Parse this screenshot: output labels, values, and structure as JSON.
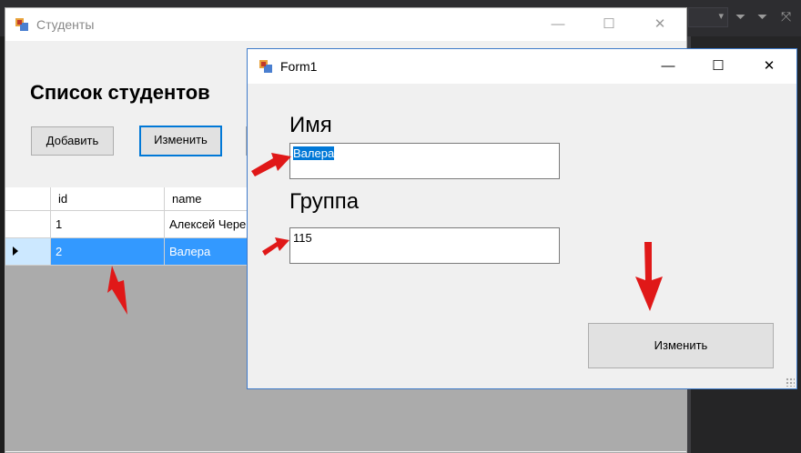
{
  "back_window": {
    "title": "Студенты",
    "heading": "Список студентов",
    "buttons": {
      "add": "Добавить",
      "edit": "Изменить"
    },
    "grid": {
      "columns": [
        "id",
        "name"
      ],
      "rows": [
        {
          "id": "1",
          "name": "Алексей Чере"
        },
        {
          "id": "2",
          "name": "Валера",
          "selected": true
        }
      ]
    }
  },
  "form": {
    "title": "Form1",
    "name_label": "Имя",
    "name_value": "Валера",
    "group_label": "Группа",
    "group_value": "115",
    "submit_label": "Изменить"
  },
  "window_controls": {
    "minimize": "—",
    "maximize": "☐",
    "close": "✕"
  },
  "colors": {
    "accent": "#0078d7",
    "selection": "#3399ff",
    "annotation": "#e01818"
  },
  "icons": [
    "app-icon",
    "minimize-icon",
    "maximize-icon",
    "close-icon",
    "row-pointer-icon",
    "filter-icon",
    "dropdown-arrow-icon"
  ]
}
